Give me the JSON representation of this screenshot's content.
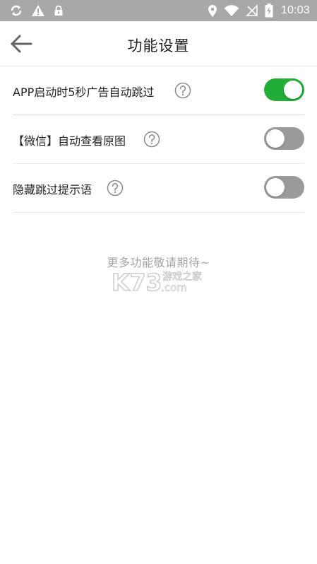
{
  "status_bar": {
    "time": "10:03",
    "left_icons": [
      "sync-icon",
      "warning-icon",
      "lock-icon"
    ],
    "right_icons": [
      "location-icon",
      "wifi-icon",
      "no-sim-icon",
      "battery-charging-icon"
    ]
  },
  "header": {
    "title": "功能设置",
    "back_icon": "arrow-left-icon"
  },
  "settings": [
    {
      "label": "APP启动时5秒广告自动跳过",
      "enabled": true
    },
    {
      "label": "【微信】自动查看原图",
      "enabled": false
    },
    {
      "label": "隐藏跳过提示语",
      "enabled": false
    }
  ],
  "footer": {
    "more_text": "更多功能敬请期待~"
  },
  "watermark": {
    "brand": "K73",
    "tagline": "游戏之家",
    "domain": ".com"
  },
  "colors": {
    "toggle_on": "#22ad38",
    "toggle_off": "#9a9a9a",
    "status_bar": "#a8a8a8"
  }
}
